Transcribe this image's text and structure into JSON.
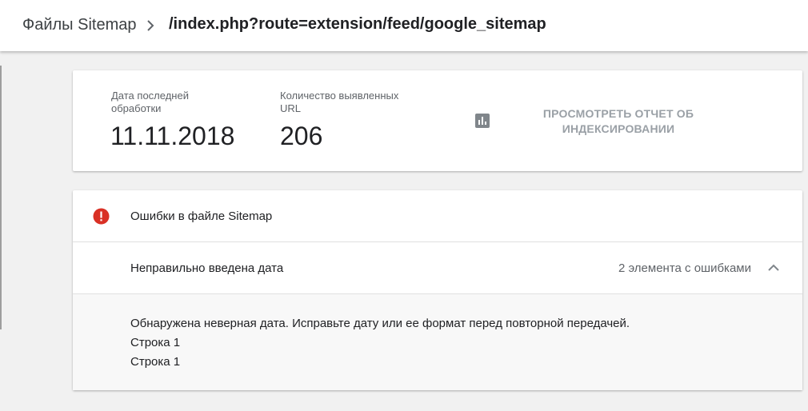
{
  "header": {
    "breadcrumb_root": "Файлы Sitemap",
    "breadcrumb_current": "/index.php?route=extension/feed/google_sitemap"
  },
  "summary": {
    "last_processed_label": "Дата последней обработки",
    "last_processed_value": "11.11.2018",
    "discovered_urls_label": "Количество выявленных URL",
    "discovered_urls_value": "206",
    "report_icon": "bar-chart-icon",
    "report_link": "ПРОСМОТРЕТЬ ОТЧЕТ ОБ ИНДЕКСИРОВАНИИ"
  },
  "errors": {
    "icon": "error-icon",
    "title": "Ошибки в файле Sitemap",
    "item": {
      "label": "Неправильно введена дата",
      "count_text": "2 элемента с ошибками",
      "expanded": true,
      "details": [
        "Обнаружена неверная дата. Исправьте дату или ее формат перед повторной передачей.",
        "Строка 1",
        "Строка 1"
      ]
    }
  },
  "colors": {
    "error_red": "#d93025",
    "disabled_text": "#9aa0a6",
    "icon_gray": "#80868b",
    "secondary_text": "#5f6368"
  }
}
